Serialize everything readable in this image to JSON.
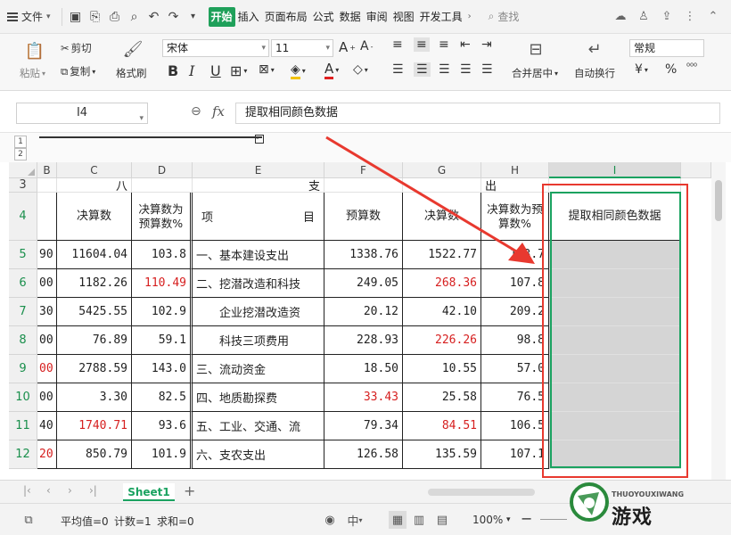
{
  "toolbar": {
    "menu_label": "文件",
    "tabs": [
      "开始",
      "插入",
      "页面布局",
      "公式",
      "数据",
      "审阅",
      "视图",
      "开发工具"
    ],
    "search_label": "查找"
  },
  "ribbon": {
    "paste": "粘贴",
    "cut": "剪切",
    "copy": "复制",
    "format_painter": "格式刷",
    "font_name": "宋体",
    "font_size": "11",
    "merge": "合并居中",
    "wrap": "自动换行",
    "num_format": "常规",
    "currency": "¥",
    "percent": "%"
  },
  "formula_bar": {
    "name_box": "I4",
    "fx": "fx",
    "formula": "提取相同颜色数据"
  },
  "outline": {
    "levels": [
      "1",
      "2"
    ]
  },
  "grid": {
    "columns": [
      "B",
      "C",
      "D",
      "E",
      "F",
      "G",
      "H",
      "I"
    ],
    "rows": [
      "3",
      "4",
      "5",
      "6",
      "7",
      "8",
      "9",
      "10",
      "11",
      "12"
    ],
    "row3": {
      "c": "八",
      "e": "支",
      "h": "出"
    },
    "header": {
      "c": "决算数",
      "d": "决算数为预算数%",
      "e_left": "项",
      "e_right": "目",
      "f": "预算数",
      "g": "决算数",
      "h": "决算数为预算数%",
      "i": "提取相同颜色数据"
    },
    "data_rows": [
      {
        "b": "90",
        "c": "11604.04",
        "d": "103.8",
        "e": "一、基本建设支出",
        "f": "1338.76",
        "g": "1522.77",
        "h": "113.7"
      },
      {
        "b": "00",
        "c": "1182.26",
        "d": "110.49",
        "e": "二、挖潜改造和科技",
        "f": "249.05",
        "g": "268.36",
        "h": "107.8"
      },
      {
        "b": "30",
        "c": "5425.55",
        "d": "102.9",
        "e": "　　企业挖潜改造资",
        "f": "20.12",
        "g": "42.10",
        "h": "209.2"
      },
      {
        "b": "00",
        "c": "76.89",
        "d": "59.1",
        "e": "　　科技三项费用",
        "f": "228.93",
        "g": "226.26",
        "h": "98.8"
      },
      {
        "b": "00",
        "c": "2788.59",
        "d": "143.0",
        "e": "三、流动资金",
        "f": "18.50",
        "g": "10.55",
        "h": "57.0"
      },
      {
        "b": "00",
        "c": "3.30",
        "d": "82.5",
        "e": "四、地质勘探费",
        "f": "33.43",
        "g": "25.58",
        "h": "76.5"
      },
      {
        "b": "40",
        "c": "1740.71",
        "d": "93.6",
        "e": "五、工业、交通、流",
        "f": "79.34",
        "g": "84.51",
        "h": "106.5"
      },
      {
        "b": "20",
        "c": "850.79",
        "d": "101.9",
        "e": "六、支农支出",
        "f": "126.58",
        "g": "135.59",
        "h": "107.1"
      }
    ]
  },
  "sheet": {
    "name": "Sheet1"
  },
  "status": {
    "average": "平均值=0",
    "count": "计数=1",
    "sum": "求和=0",
    "zoom": "100%"
  },
  "watermark": {
    "main": "游戏",
    "sub": "THUOYOUXIWANG"
  },
  "colors": {
    "accent": "#1aa260",
    "red_text": "#d61f1f",
    "annotation": "#e8392f"
  }
}
